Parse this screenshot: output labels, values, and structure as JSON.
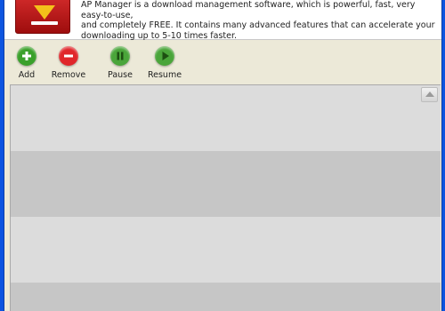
{
  "header": {
    "description_lines": [
      "AP Manager is a download management software, which is powerful, fast, very easy-to-use,",
      "and completely FREE. It contains many advanced features that can accelerate your",
      "downloading up to 5-10 times faster."
    ],
    "logo_icon": "download-logo-icon"
  },
  "toolbar": {
    "buttons": [
      {
        "label": "Add",
        "icon": "plus-icon",
        "color": "#3aa02a"
      },
      {
        "label": "Remove",
        "icon": "minus-icon",
        "color": "#e0262a"
      },
      {
        "label": "Pause",
        "icon": "pause-icon",
        "color": "#4aa53a"
      },
      {
        "label": "Resume",
        "icon": "play-icon",
        "color": "#4aa53a"
      }
    ]
  },
  "download_list": {
    "rows": [
      {
        "color": "#dcdcdc"
      },
      {
        "color": "#c6c6c6"
      },
      {
        "color": "#dcdcdc"
      },
      {
        "color": "#c6c6c6"
      }
    ]
  },
  "colors": {
    "window_frame": "#0d55e0",
    "window_bg": "#ece9d8",
    "logo_red": "#c11d1d",
    "logo_yellow": "#f3c21a"
  }
}
